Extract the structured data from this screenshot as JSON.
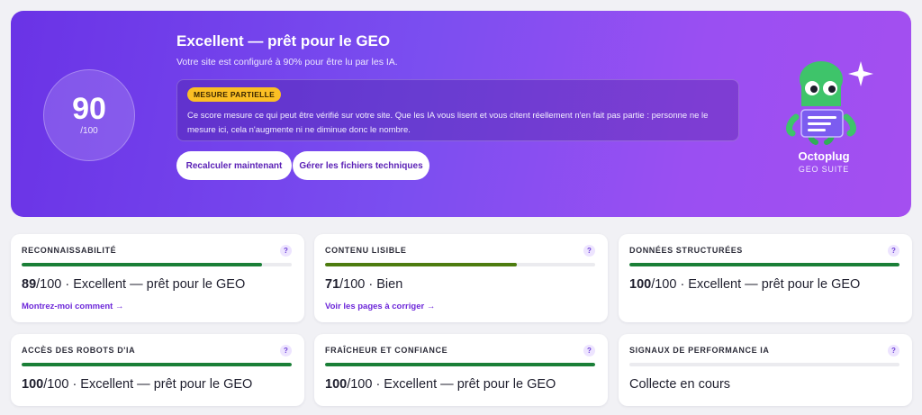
{
  "hero": {
    "score": "90",
    "score_max": "/100",
    "title": "Excellent — prêt pour le GEO",
    "subtitle": "Votre site est configuré à 90% pour être lu par les IA.",
    "notice_badge": "MESURE PARTIELLE",
    "notice_text": "Ce score mesure ce qui peut être vérifié sur votre site. Que les IA vous lisent et vous citent réellement n'en fait pas partie : personne ne le mesure ici, cela n'augmente ni ne diminue donc le nombre.",
    "btn_recalc": "Recalculer maintenant",
    "btn_files": "Gérer les fichiers techniques",
    "brand_name": "Octoplug",
    "brand_sub": "GEO SUITE"
  },
  "colors": {
    "bar_good": "#1a7f37",
    "bar_fair": "#4d7c0f",
    "accent": "#6d28d9",
    "badge": "#fbbf24"
  },
  "cards": [
    {
      "label": "Reconnaissabilité",
      "help": "?",
      "progress": 0.89,
      "bar": "good",
      "score": "89",
      "rest": "/100 · Excellent — prêt pour le GEO",
      "link": "Montrez-moi comment →"
    },
    {
      "label": "Contenu lisible",
      "help": "?",
      "progress": 0.71,
      "bar": "fair",
      "score": "71",
      "rest": "/100 · Bien",
      "link": "Voir les pages à corriger →"
    },
    {
      "label": "Données structurées",
      "help": "?",
      "progress": 1.0,
      "bar": "good",
      "score": "100",
      "rest": "/100 · Excellent — prêt pour le GEO",
      "link": ""
    },
    {
      "label": "Accès des robots d'IA",
      "help": "?",
      "progress": 1.0,
      "bar": "good",
      "score": "100",
      "rest": "/100 · Excellent — prêt pour le GEO",
      "link": ""
    },
    {
      "label": "Fraîcheur et confiance",
      "help": "?",
      "progress": 1.0,
      "bar": "good",
      "score": "100",
      "rest": "/100 · Excellent — prêt pour le GEO",
      "link": ""
    },
    {
      "label": "Signaux de performance IA",
      "help": "?",
      "progress": 0,
      "bar": "good",
      "score": "",
      "rest": "Collecte en cours",
      "link": ""
    }
  ]
}
